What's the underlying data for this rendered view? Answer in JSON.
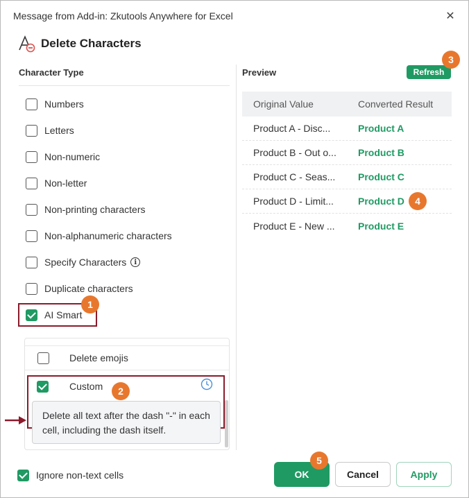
{
  "window": {
    "title": "Message from Add-in: Zkutools Anywhere for Excel"
  },
  "header": {
    "title": "Delete Characters",
    "logo_icon": "delete-characters-icon"
  },
  "character_type": {
    "label": "Character Type",
    "options": [
      {
        "label": "Numbers",
        "checked": false
      },
      {
        "label": "Letters",
        "checked": false
      },
      {
        "label": "Non-numeric",
        "checked": false
      },
      {
        "label": "Non-letter",
        "checked": false
      },
      {
        "label": "Non-printing characters",
        "checked": false
      },
      {
        "label": "Non-alphanumeric characters",
        "checked": false
      },
      {
        "label": "Specify Characters",
        "checked": false,
        "info_icon": "i"
      },
      {
        "label": "Duplicate characters",
        "checked": false
      },
      {
        "label": "AI Smart",
        "checked": true
      }
    ]
  },
  "ai_panel": {
    "items": [
      {
        "label": "Delete emojis",
        "checked": false
      },
      {
        "label": "Custom",
        "checked": true,
        "icon": "clock-icon"
      }
    ],
    "custom_prompt": "Delete all text after the dash \"-\" in each cell, including the dash itself."
  },
  "preview": {
    "label": "Preview",
    "refresh_label": "Refresh",
    "columns": [
      "Original Value",
      "Converted Result"
    ],
    "rows": [
      {
        "original": "Product A - Disc...",
        "converted": "Product A"
      },
      {
        "original": "Product B - Out o...",
        "converted": "Product B"
      },
      {
        "original": "Product C - Seas...",
        "converted": "Product C"
      },
      {
        "original": "Product D - Limit...",
        "converted": "Product D"
      },
      {
        "original": "Product E - New ...",
        "converted": "Product E"
      }
    ]
  },
  "footer": {
    "ignore_label": "Ignore non-text cells",
    "ignore_checked": true,
    "ok_label": "OK",
    "cancel_label": "Cancel",
    "apply_label": "Apply"
  },
  "callouts": [
    "1",
    "2",
    "3",
    "4",
    "5"
  ],
  "colors": {
    "accent_green": "#1f9a63",
    "callout_orange": "#e8772e",
    "highlight_red": "#8b1a2b"
  }
}
